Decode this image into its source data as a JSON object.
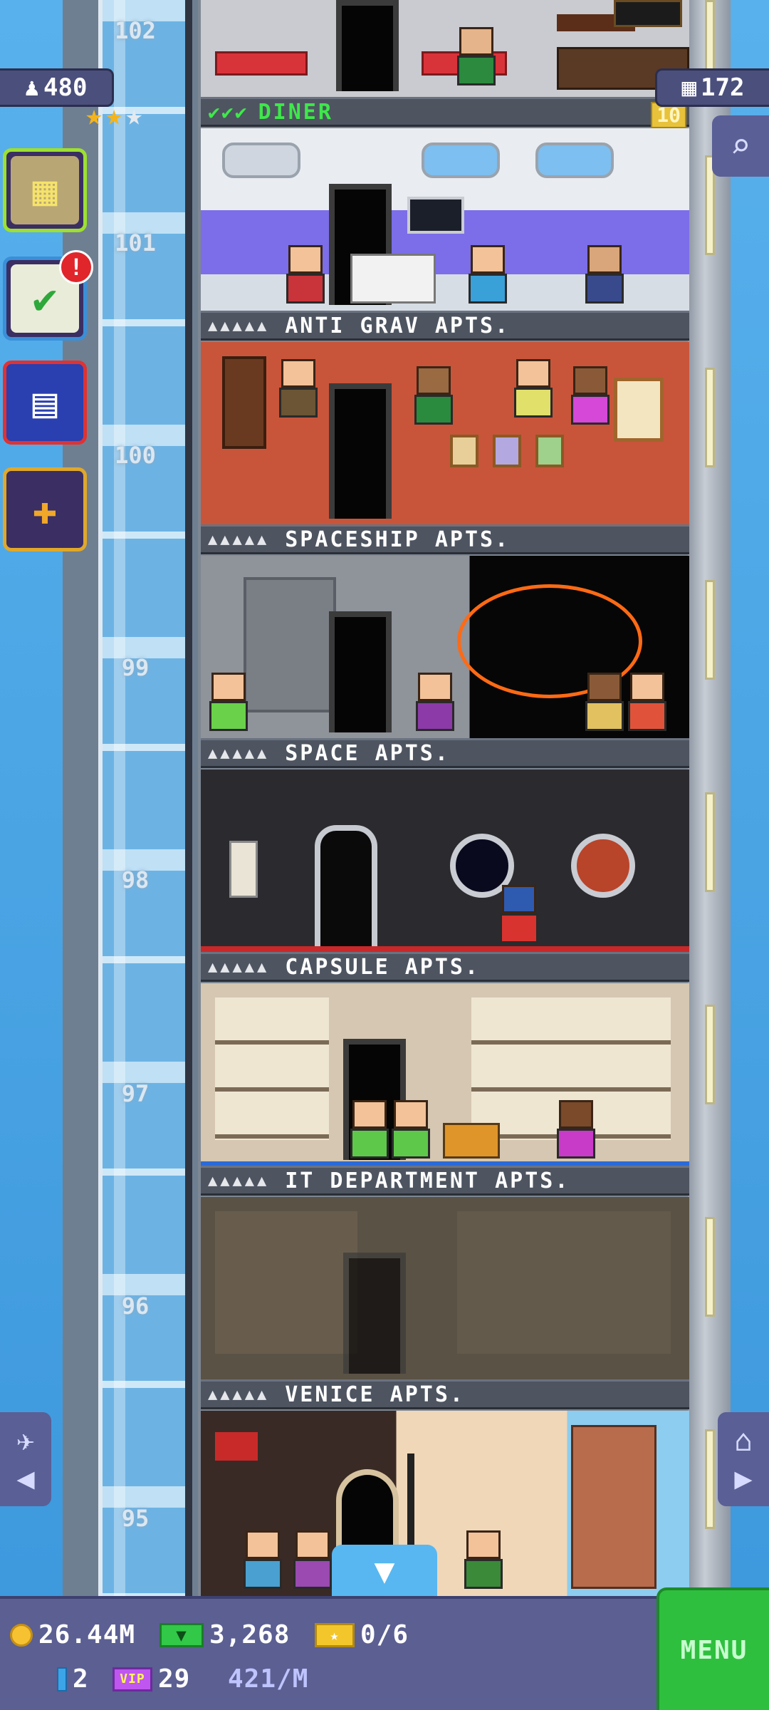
{
  "floors": [
    {
      "number": "102",
      "name": "DINER",
      "checks": "✔✔✔",
      "level": "10",
      "kind": "diner"
    },
    {
      "number": "101",
      "name": "ANTI GRAV APTS.",
      "dots": "▲▲▲▲▲"
    },
    {
      "number": "100",
      "name": "SPACESHIP APTS.",
      "dots": "▲▲▲▲▲"
    },
    {
      "number": "99",
      "name": "SPACE APTS.",
      "dots": "▲▲▲▲▲"
    },
    {
      "number": "98",
      "name": "CAPSULE APTS.",
      "dots": "▲▲▲▲▲"
    },
    {
      "number": "97",
      "name": "IT DEPARTMENT APTS.",
      "dots": "▲▲▲▲▲"
    },
    {
      "number": "96",
      "name": "VENICE APTS.",
      "dots": "▲▲▲▲▲"
    },
    {
      "number": "95"
    }
  ],
  "hud": {
    "population": "480",
    "population_icon": "person-icon",
    "floors_count": "172",
    "floors_icon": "building-icon",
    "stars": {
      "gold": 2,
      "silver": 1
    },
    "notification_count": "!"
  },
  "bottom_bar": {
    "coins": "26.44M",
    "bux": "3,268",
    "tickets": "0/6",
    "tower_count": "2",
    "vip": "29",
    "rate": "421/M",
    "menu_label": "MENU"
  },
  "colors": {
    "sky": "#4aa3e4",
    "hud_panel": "#5b5f92",
    "menu_green": "#2fbf3f",
    "check_green": "#3ee84a",
    "coin_gold": "#f6c232"
  }
}
